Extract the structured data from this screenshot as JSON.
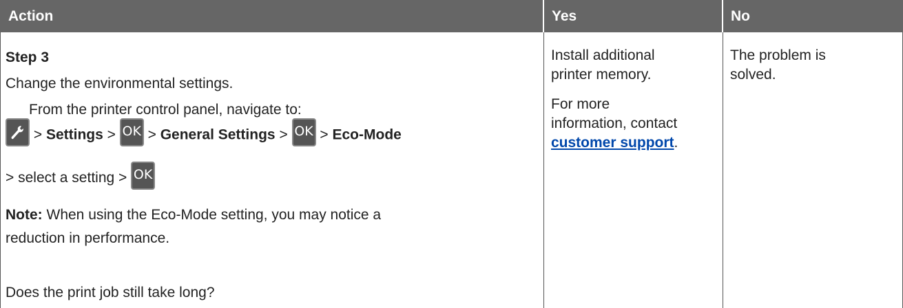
{
  "table": {
    "headers": {
      "action": "Action",
      "yes": "Yes",
      "no": "No"
    },
    "action": {
      "step": "Step 3",
      "intro": "Change the environmental settings.",
      "nav_intro": "From the printer control panel, navigate to:",
      "sep": ">",
      "settings": "Settings",
      "general_settings": "General Settings",
      "eco_mode": "Eco-Mode",
      "select_setting": "> select a setting >",
      "ok_label": "OK",
      "note_label": "Note:",
      "note_line1": " When using the Eco-Mode setting, you may notice a",
      "note_line2": "reduction in performance.",
      "question": "Does the print job still take long?"
    },
    "yes": {
      "line1": "Install additional",
      "line2": "printer memory.",
      "line3": "For more",
      "line4": "information, contact",
      "link": "customer support",
      "link_suffix": "."
    },
    "no": {
      "line1": "The problem is",
      "line2": "solved."
    }
  },
  "colors": {
    "header_bg": "#666666",
    "header_text": "#ffffff",
    "body_text": "#222222",
    "icon_bg": "#555555",
    "link": "#0047ab"
  },
  "icons": {
    "wrench": "wrench-icon",
    "ok": "ok-button-icon"
  }
}
